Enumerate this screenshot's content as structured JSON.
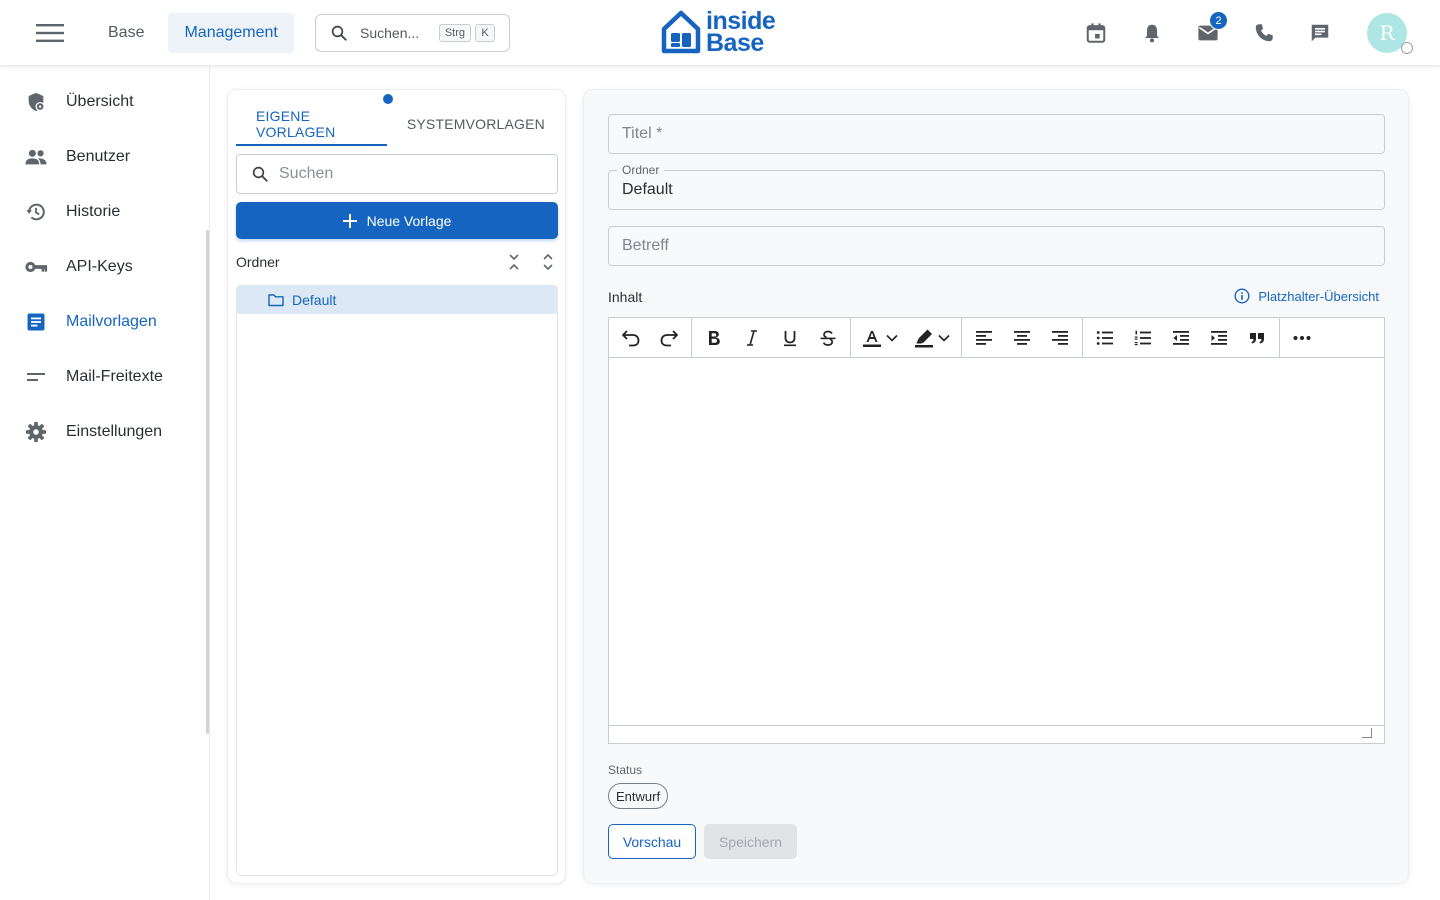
{
  "topbar": {
    "nav": [
      "Base",
      "Management"
    ],
    "active_nav": "Management",
    "search": {
      "placeholder": "Suchen...",
      "shortcut_mod": "Strg",
      "shortcut_key": "K"
    },
    "logo": {
      "line1": "inside",
      "line2": "Base"
    },
    "mail_badge": "2",
    "avatar_initial": "R",
    "icons": [
      "calendar-icon",
      "bell-icon",
      "mail-icon",
      "phone-icon",
      "chat-icon"
    ]
  },
  "sidebar": {
    "items": [
      {
        "label": "Übersicht",
        "icon": "shield-gear-icon",
        "active": false
      },
      {
        "label": "Benutzer",
        "icon": "users-icon",
        "active": false
      },
      {
        "label": "Historie",
        "icon": "history-icon",
        "active": false
      },
      {
        "label": "API-Keys",
        "icon": "key-icon",
        "active": false
      },
      {
        "label": "Mailvorlagen",
        "icon": "document-icon",
        "active": true
      },
      {
        "label": "Mail-Freitexte",
        "icon": "short-text-icon",
        "active": false
      },
      {
        "label": "Einstellungen",
        "icon": "gear-icon",
        "active": false
      }
    ]
  },
  "templates_panel": {
    "tabs": [
      "EIGENE VORLAGEN",
      "SYSTEMVORLAGEN"
    ],
    "active_tab": "EIGENE VORLAGEN",
    "search_placeholder": "Suchen",
    "new_button": "Neue Vorlage",
    "folder_header": "Ordner",
    "folders": [
      "Default"
    ]
  },
  "editor_panel": {
    "title_placeholder": "Titel *",
    "folder_label": "Ordner",
    "folder_value": "Default",
    "subject_placeholder": "Betreff",
    "content_label": "Inhalt",
    "placeholder_link": "Platzhalter-Übersicht",
    "status_label": "Status",
    "status_value": "Entwurf",
    "preview_button": "Vorschau",
    "save_button": "Speichern"
  },
  "colors": {
    "accent": "#1565c0",
    "selected_bg": "#dde8f5",
    "avatar_bg": "#aee6e3"
  }
}
